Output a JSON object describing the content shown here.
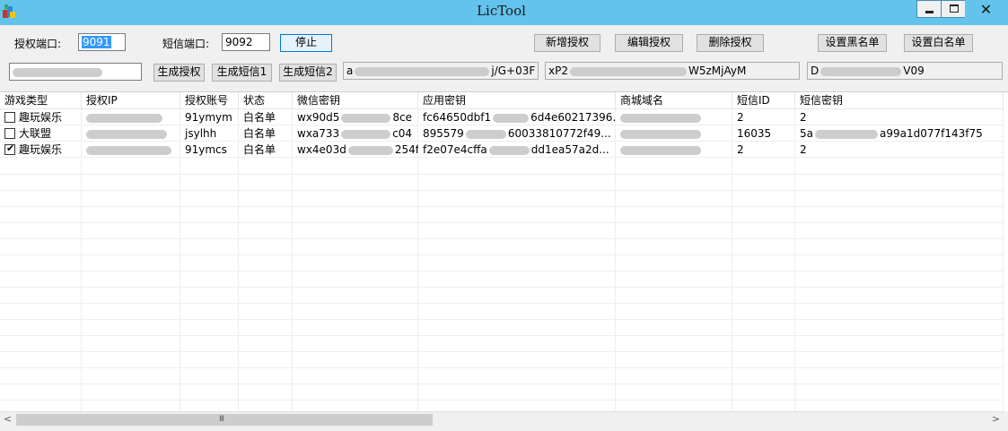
{
  "window": {
    "title": "LicTool",
    "minimize_glyph": "",
    "close_glyph": "✕"
  },
  "controls": {
    "auth_port_label": "授权端口:",
    "auth_port_value": "9091",
    "sms_port_label": "短信端口:",
    "sms_port_value": "9092",
    "stop_button": "停止",
    "add_auth_button": "新增授权",
    "edit_auth_button": "编辑授权",
    "delete_auth_button": "删除授权",
    "set_blacklist_button": "设置黑名单",
    "set_whitelist_button": "设置白名单",
    "gen_auth_button": "生成授权",
    "gen_sms1_button": "生成短信1",
    "gen_sms2_button": "生成短信2",
    "field_ip_visible": "",
    "field_key1_prefix": "a",
    "field_key1_suffix": "j/G+03F",
    "field_key2_prefix": "xP2",
    "field_key2_suffix": "W5zMjAyM",
    "field_key3_prefix": "D",
    "field_key3_suffix": "V09"
  },
  "table": {
    "headers": [
      "游戏类型",
      "授权IP",
      "授权账号",
      "状态",
      "微信密钥",
      "应用密钥",
      "商城域名",
      "短信ID",
      "短信密钥"
    ],
    "rows": [
      {
        "checked": false,
        "game": "趣玩娱乐",
        "ip": "",
        "account": "91ymym",
        "status": "白名单",
        "wx_prefix": "wx90d5",
        "wx_suffix": "8ce",
        "app_prefix": "fc64650dbf1",
        "app_suffix": "6d4e60217396...",
        "domain": "",
        "sms_id": "2",
        "sms_key": "2"
      },
      {
        "checked": false,
        "game": "大联盟",
        "ip": "",
        "account": "jsylhh",
        "status": "白名单",
        "wx_prefix": "wxa733",
        "wx_suffix": "c04",
        "app_prefix": "895579",
        "app_suffix": "60033810772f49...",
        "domain": "",
        "sms_id": "16035",
        "sms_key": "5a",
        "sms_key_suffix": "a99a1d077f143f75"
      },
      {
        "checked": true,
        "game": "趣玩娱乐",
        "ip": "",
        "account": "91ymcs",
        "status": "白名单",
        "wx_prefix": "wx4e03d",
        "wx_suffix": "254f",
        "app_prefix": "f2e07e4cffa",
        "app_suffix": "dd1ea57a2d...",
        "domain": "",
        "sms_id": "2",
        "sms_key": "2"
      }
    ]
  },
  "scrollbar": {
    "left_arrow": "<",
    "right_arrow": ">",
    "grip": "III"
  }
}
